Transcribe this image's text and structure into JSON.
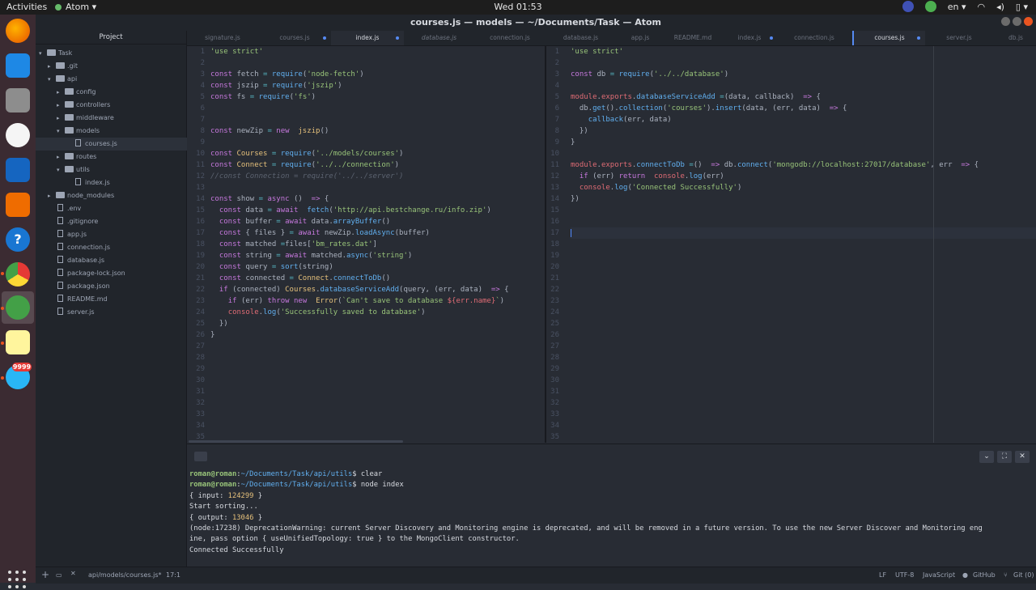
{
  "topbar": {
    "activities": "Activities",
    "app_name": "Atom",
    "clock": "Wed 01:53",
    "lang": "en"
  },
  "window": {
    "title": "courses.js — models — ~/Documents/Task — Atom"
  },
  "dock": {
    "badge": "9999"
  },
  "sidebar": {
    "header": "Project",
    "items": [
      {
        "label": "Task",
        "type": "folder",
        "open": true
      },
      {
        "label": ".git",
        "type": "folder"
      },
      {
        "label": "api",
        "type": "folder",
        "open": true
      },
      {
        "label": "config",
        "type": "folder"
      },
      {
        "label": "controllers",
        "type": "folder"
      },
      {
        "label": "middleware",
        "type": "folder"
      },
      {
        "label": "models",
        "type": "folder",
        "open": true
      },
      {
        "label": "courses.js",
        "type": "file",
        "selected": true
      },
      {
        "label": "routes",
        "type": "folder"
      },
      {
        "label": "utils",
        "type": "folder",
        "open": true
      },
      {
        "label": "index.js",
        "type": "file"
      },
      {
        "label": "node_modules",
        "type": "folder"
      },
      {
        "label": ".env",
        "type": "file"
      },
      {
        "label": ".gitignore",
        "type": "file"
      },
      {
        "label": "app.js",
        "type": "file"
      },
      {
        "label": "connection.js",
        "type": "file"
      },
      {
        "label": "database.js",
        "type": "file"
      },
      {
        "label": "package-lock.json",
        "type": "file"
      },
      {
        "label": "package.json",
        "type": "file"
      },
      {
        "label": "README.md",
        "type": "file"
      },
      {
        "label": "server.js",
        "type": "file"
      }
    ]
  },
  "tabs": [
    {
      "label": "signature.js"
    },
    {
      "label": "courses.js",
      "modified": true
    },
    {
      "label": "index.js",
      "modified": true,
      "active": true
    },
    {
      "label": "database.js",
      "italic": true
    },
    {
      "label": "connection.js"
    },
    {
      "label": "database.js"
    },
    {
      "label": "app.js"
    },
    {
      "label": "README.md"
    },
    {
      "label": "index.js",
      "modified": true
    },
    {
      "label": "connection.js"
    },
    {
      "label": "courses.js",
      "modified": true,
      "active": true
    },
    {
      "label": "server.js"
    },
    {
      "label": "db.js"
    }
  ],
  "left_editor": {
    "line_count": 35,
    "lines": [
      [
        [
          "s",
          "'use strict'"
        ]
      ],
      [],
      [
        [
          "k",
          "const"
        ],
        [
          "",
          "fetch "
        ],
        [
          "o",
          "="
        ],
        [
          "f",
          " require"
        ],
        [
          "",
          "("
        ],
        [
          "s",
          "'node-fetch'"
        ],
        [
          "",
          ")"
        ]
      ],
      [
        [
          "k",
          "const"
        ],
        [
          "",
          "jszip "
        ],
        [
          "o",
          "="
        ],
        [
          "f",
          " require"
        ],
        [
          "",
          "("
        ],
        [
          "s",
          "'jszip'"
        ],
        [
          "",
          ")"
        ]
      ],
      [
        [
          "k",
          "const"
        ],
        [
          "",
          "fs "
        ],
        [
          "o",
          "="
        ],
        [
          "f",
          " require"
        ],
        [
          "",
          "("
        ],
        [
          "s",
          "'fs'"
        ],
        [
          "",
          ")"
        ]
      ],
      [],
      [],
      [
        [
          "k",
          "const"
        ],
        [
          "",
          "newZip "
        ],
        [
          "o",
          "="
        ],
        [
          "k",
          " new"
        ],
        [
          "t",
          " jszip"
        ],
        [
          "",
          "()"
        ]
      ],
      [],
      [
        [
          "k",
          "const"
        ],
        [
          "t",
          "Courses"
        ],
        [
          "o",
          " ="
        ],
        [
          "f",
          " require"
        ],
        [
          "",
          "("
        ],
        [
          "s",
          "'../models/courses'"
        ],
        [
          "",
          ")"
        ]
      ],
      [
        [
          "k",
          "const"
        ],
        [
          "t",
          "Connect"
        ],
        [
          "o",
          " ="
        ],
        [
          "f",
          " require"
        ],
        [
          "",
          "("
        ],
        [
          "s",
          "'../../connection'"
        ],
        [
          "",
          ")"
        ]
      ],
      [
        [
          "c",
          "//const Connection = require('../../server')"
        ]
      ],
      [],
      [
        [
          "k",
          "const"
        ],
        [
          "",
          "show "
        ],
        [
          "o",
          "="
        ],
        [
          "k",
          " async"
        ],
        [
          "",
          ""
        ],
        [
          "",
          "() "
        ],
        [
          "k",
          "=>"
        ],
        [
          "",
          ""
        ],
        [
          "",
          "{"
        ]
      ],
      [
        [
          "",
          "  "
        ],
        [
          "k",
          "const"
        ],
        [
          "",
          "data "
        ],
        [
          "o",
          "="
        ],
        [
          "k",
          " await"
        ],
        [
          "f",
          " fetch"
        ],
        [
          "",
          "("
        ],
        [
          "s",
          "'http://api.bestchange.ru/info.zip'"
        ],
        [
          "",
          ")"
        ]
      ],
      [
        [
          "",
          "  "
        ],
        [
          "k",
          "const"
        ],
        [
          "",
          "buffer "
        ],
        [
          "o",
          "="
        ],
        [
          "k",
          " await"
        ],
        [
          "",
          "data."
        ],
        [
          "f",
          "arrayBuffer"
        ],
        [
          "",
          "()"
        ]
      ],
      [
        [
          "",
          "  "
        ],
        [
          "k",
          "const"
        ],
        [
          "",
          "{ files } "
        ],
        [
          "o",
          "="
        ],
        [
          "k",
          " await"
        ],
        [
          "",
          "newZip."
        ],
        [
          "f",
          "loadAsync"
        ],
        [
          "",
          "(buffer)"
        ]
      ],
      [
        [
          "",
          "  "
        ],
        [
          "k",
          "const"
        ],
        [
          "",
          "matched "
        ],
        [
          "o",
          "="
        ],
        [
          "",
          "files["
        ],
        [
          "s",
          "'bm_rates.dat'"
        ],
        [
          "",
          "]"
        ]
      ],
      [
        [
          "",
          "  "
        ],
        [
          "k",
          "const"
        ],
        [
          "",
          "string "
        ],
        [
          "o",
          "="
        ],
        [
          "k",
          " await"
        ],
        [
          "",
          "matched."
        ],
        [
          "f",
          "async"
        ],
        [
          "",
          "("
        ],
        [
          "s",
          "'string'"
        ],
        [
          "",
          ")"
        ]
      ],
      [
        [
          "",
          "  "
        ],
        [
          "k",
          "const"
        ],
        [
          "",
          "query "
        ],
        [
          "o",
          "="
        ],
        [
          "f",
          " sort"
        ],
        [
          "",
          "(string)"
        ]
      ],
      [
        [
          "",
          "  "
        ],
        [
          "k",
          "const"
        ],
        [
          "",
          "connected "
        ],
        [
          "o",
          "="
        ],
        [
          "t",
          " Connect"
        ],
        [
          "",
          "."
        ],
        [
          "f",
          "connectToDb"
        ],
        [
          "",
          "()"
        ]
      ],
      [
        [
          "",
          "  "
        ],
        [
          "k",
          "if"
        ],
        [
          "",
          "(connected) "
        ],
        [
          "t",
          "Courses"
        ],
        [
          "",
          "."
        ],
        [
          "f",
          "databaseServiceAdd"
        ],
        [
          "",
          "(query, (err, data) "
        ],
        [
          "k",
          "=>"
        ],
        [
          "",
          ""
        ],
        [
          "",
          "{"
        ]
      ],
      [
        [
          "",
          "    "
        ],
        [
          "k",
          "if"
        ],
        [
          "",
          "(err) "
        ],
        [
          "k",
          "throw new"
        ],
        [
          "t",
          " Error"
        ],
        [
          "",
          "("
        ],
        [
          "s",
          "`Can't save to database "
        ],
        [
          "v",
          "${err.name}"
        ],
        [
          "s",
          "`"
        ],
        [
          "",
          ")"
        ]
      ],
      [
        [
          "",
          "    "
        ],
        [
          "v",
          "console"
        ],
        [
          "",
          "."
        ],
        [
          "f",
          "log"
        ],
        [
          "",
          "("
        ],
        [
          "s",
          "'Successfully saved to database'"
        ],
        [
          "",
          ")"
        ]
      ],
      [
        [
          "",
          "  })"
        ]
      ],
      [
        [
          "",
          "}"
        ]
      ]
    ]
  },
  "right_editor": {
    "line_count": 35,
    "cursor_line": 17,
    "lines": [
      [
        [
          "s",
          "'use strict'"
        ]
      ],
      [],
      [
        [
          "k",
          "const"
        ],
        [
          "",
          "db "
        ],
        [
          "o",
          "="
        ],
        [
          "f",
          " require"
        ],
        [
          "",
          "("
        ],
        [
          "s",
          "'../../database'"
        ],
        [
          "",
          ")"
        ]
      ],
      [],
      [
        [
          "v",
          "module"
        ],
        [
          "",
          "."
        ],
        [
          "v",
          "exports"
        ],
        [
          "",
          "."
        ],
        [
          "f",
          "databaseServiceAdd"
        ],
        [
          "o",
          " ="
        ],
        [
          "",
          ""
        ],
        [
          "",
          "(data, callback) "
        ],
        [
          "k",
          "=>"
        ],
        [
          "",
          ""
        ],
        [
          "",
          "{"
        ]
      ],
      [
        [
          "",
          "  db."
        ],
        [
          "f",
          "get"
        ],
        [
          "",
          "()."
        ],
        [
          "f",
          "collection"
        ],
        [
          "",
          "("
        ],
        [
          "s",
          "'courses'"
        ],
        [
          "",
          ")."
        ],
        [
          "f",
          "insert"
        ],
        [
          "",
          "(data, (err, data) "
        ],
        [
          "k",
          "=>"
        ],
        [
          "",
          ""
        ],
        [
          "",
          "{"
        ]
      ],
      [
        [
          "",
          "    "
        ],
        [
          "f",
          "callback"
        ],
        [
          "",
          "(err, data)"
        ]
      ],
      [
        [
          "",
          "  })"
        ]
      ],
      [
        [
          "",
          "}"
        ]
      ],
      [],
      [
        [
          "v",
          "module"
        ],
        [
          "",
          "."
        ],
        [
          "v",
          "exports"
        ],
        [
          "",
          "."
        ],
        [
          "f",
          "connectToDb"
        ],
        [
          "o",
          " ="
        ],
        [
          "",
          ""
        ],
        [
          "",
          "() "
        ],
        [
          "k",
          "=>"
        ],
        [
          "",
          ""
        ],
        [
          "",
          "db."
        ],
        [
          "f",
          "connect"
        ],
        [
          "",
          "("
        ],
        [
          "s",
          "'mongodb://localhost:27017/database'"
        ],
        [
          "",
          ", err "
        ],
        [
          "k",
          "=>"
        ],
        [
          "",
          ""
        ],
        [
          "",
          "{"
        ]
      ],
      [
        [
          "",
          "  "
        ],
        [
          "k",
          "if"
        ],
        [
          "",
          "(err) "
        ],
        [
          "k",
          "return"
        ],
        [
          "v",
          " console"
        ],
        [
          "",
          "."
        ],
        [
          "f",
          "log"
        ],
        [
          "",
          "(err)"
        ]
      ],
      [
        [
          "",
          "  "
        ],
        [
          "v",
          "console"
        ],
        [
          "",
          "."
        ],
        [
          "f",
          "log"
        ],
        [
          "",
          "("
        ],
        [
          "s",
          "'Connected Successfully'"
        ],
        [
          "",
          ")"
        ]
      ],
      [
        [
          "",
          "})"
        ]
      ]
    ]
  },
  "terminal": {
    "lines": [
      [
        [
          "tu",
          "roman@roman"
        ],
        [
          "",
          ":"
        ],
        [
          "tp",
          "~/Documents/Task/api/utils"
        ],
        [
          "",
          "$ clear"
        ]
      ],
      [
        [
          "tu",
          "roman@roman"
        ],
        [
          "",
          ":"
        ],
        [
          "tp",
          "~/Documents/Task/api/utils"
        ],
        [
          "",
          "$ node index"
        ]
      ],
      [
        [
          "",
          "{ input: "
        ],
        [
          "tn",
          "124299"
        ],
        [
          "",
          " }"
        ]
      ],
      [
        [
          "",
          "Start sorting..."
        ]
      ],
      [
        [
          "",
          "{ output: "
        ],
        [
          "tn",
          "13046"
        ],
        [
          "",
          " }"
        ]
      ],
      [
        [
          "",
          "(node:17238) DeprecationWarning: current Server Discovery and Monitoring engine is deprecated, and will be removed in a future version. To use the new Server Discover and Monitoring eng"
        ]
      ],
      [
        [
          "",
          "ine, pass option { useUnifiedTopology: true } to the MongoClient constructor."
        ]
      ],
      [
        [
          "",
          "Connected Successfully"
        ]
      ]
    ]
  },
  "statusbar": {
    "file_path": "api/models/courses.js*",
    "cursor": "17:1",
    "line_ending": "LF",
    "encoding": "UTF-8",
    "grammar": "JavaScript",
    "github": "GitHub",
    "git": "Git (0)"
  }
}
